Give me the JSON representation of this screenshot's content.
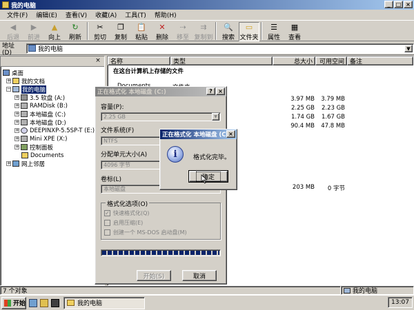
{
  "window": {
    "title": "我的电脑"
  },
  "menu": [
    "文件(F)",
    "编辑(E)",
    "查看(V)",
    "收藏(A)",
    "工具(T)",
    "帮助(H)"
  ],
  "toolbar": {
    "back": "后退",
    "forward": "前进",
    "up": "向上",
    "refresh": "刷新",
    "cut": "剪切",
    "copy": "复制",
    "paste": "粘贴",
    "delete": "删除",
    "move_to": "移至",
    "copy_to": "复制到",
    "search": "搜索",
    "folders": "文件夹",
    "properties": "属性",
    "views": "查看"
  },
  "address": {
    "label": "地址(D)",
    "value": "我的电脑"
  },
  "tree": {
    "items": [
      {
        "label": "桌面"
      },
      {
        "label": "我的文档"
      },
      {
        "label": "我的电脑"
      },
      {
        "label": "3.5 软盘 (A:)"
      },
      {
        "label": "RAMDisk (B:)"
      },
      {
        "label": "本地磁盘 (C:)"
      },
      {
        "label": "本地磁盘 (D:)"
      },
      {
        "label": "DEEPINXP-5.5SP-T (E:)"
      },
      {
        "label": "Mini XPE (X:)"
      },
      {
        "label": "控制面板"
      },
      {
        "label": "Documents"
      },
      {
        "label": "网上邻居"
      }
    ]
  },
  "list": {
    "columns": {
      "name": "名称",
      "type": "类型",
      "total": "总大小",
      "free": "可用空间",
      "note": "备注"
    },
    "group_header": "在这台计算机上存储的文件",
    "partial_row": {
      "name": "Documents",
      "type": "文件夹"
    },
    "rows": [
      {
        "total": "3.97 MB",
        "free": "3.79 MB"
      },
      {
        "total": "2.25 GB",
        "free": "2.23 GB"
      },
      {
        "total": "1.74 GB",
        "free": "1.67 GB"
      },
      {
        "total": "90.4 MB",
        "free": "47.8 MB"
      },
      {
        "total": "203 MB",
        "free": "0 字节"
      }
    ]
  },
  "status": {
    "count": "7 个对象",
    "location": "我的电脑"
  },
  "format_dialog": {
    "title": "正在格式化 本地磁盘 (C:)",
    "capacity_label": "容量(P):",
    "capacity_value": "2.25 GB",
    "filesystem_label": "文件系统(F)",
    "filesystem_value": "NTFS",
    "cluster_label": "分配单元大小(A)",
    "cluster_value": "4096 字节",
    "volume_label": "卷标(L)",
    "volume_value": "本地磁盘",
    "options_title": "格式化选项(O)",
    "opt_quick": "快速格式化(Q)",
    "opt_compress": "启用压缩(E)",
    "opt_msdos": "创建一个 MS-DOS 启动盘(M)",
    "start_button": "开始(S)",
    "cancel_button": "取消",
    "progress": 1.0
  },
  "message_box": {
    "title": "正在格式化 本地磁盘 (C:)",
    "text": "格式化完毕。",
    "ok_button": "确定"
  },
  "taskbar": {
    "start": "开始",
    "task": "我的电脑",
    "clock": "13:07"
  }
}
